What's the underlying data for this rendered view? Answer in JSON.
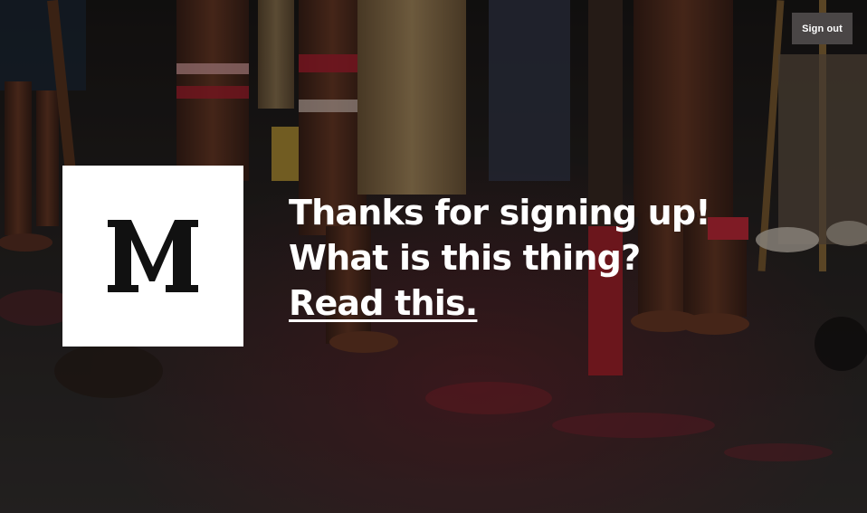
{
  "header": {
    "sign_out_label": "Sign out"
  },
  "logo": {
    "letter": "M",
    "background_color": "#ffffff",
    "letter_color": "#111111"
  },
  "main": {
    "headline_line1": "Thanks for signing up!",
    "headline_line2": "What is this thing?",
    "read_link_label": "Read this."
  },
  "colors": {
    "overlay": "#1c1a1a",
    "button": "#4a4646",
    "text": "#ffffff",
    "accent_red": "#c8323c"
  },
  "background": {
    "icon": "photo-background"
  }
}
